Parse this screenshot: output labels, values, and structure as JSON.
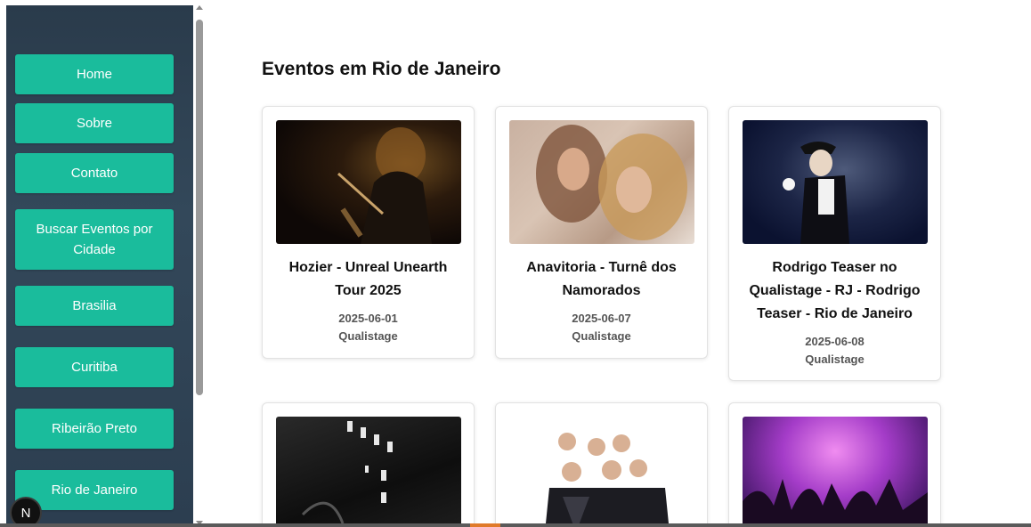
{
  "sidebar": {
    "items": [
      {
        "label": "Home"
      },
      {
        "label": "Sobre"
      },
      {
        "label": "Contato"
      },
      {
        "label": "Buscar Eventos por Cidade"
      },
      {
        "label": "Brasilia"
      },
      {
        "label": "Curitiba"
      },
      {
        "label": "Ribeirão Preto"
      },
      {
        "label": "Rio de Janeiro"
      }
    ],
    "badge_letter": "N"
  },
  "main": {
    "title": "Eventos em Rio de Janeiro",
    "events": [
      {
        "title": "Hozier - Unreal Unearth Tour 2025",
        "date": "2025-06-01",
        "venue": "Qualistage",
        "image": "hozier-concert-photo"
      },
      {
        "title": "Anavitoria - Turnê dos Namorados",
        "date": "2025-06-07",
        "venue": "Qualistage",
        "image": "anavitoria-duo-photo"
      },
      {
        "title": "Rodrigo Teaser no Qualistage - RJ - Rodrigo Teaser - Rio de Janeiro",
        "date": "2025-06-08",
        "venue": "Qualistage",
        "image": "rodrigo-teaser-photo"
      },
      {
        "title": "",
        "date": "",
        "venue": "",
        "image": "stage-lights-photo"
      },
      {
        "title": "",
        "date": "",
        "venue": "",
        "image": "band-group-photo"
      },
      {
        "title": "",
        "date": "",
        "venue": "",
        "image": "crowd-party-photo"
      }
    ]
  },
  "colors": {
    "sidebar_bg": "#2c3e50",
    "button": "#1abc9c",
    "button_text": "#ffffff"
  }
}
